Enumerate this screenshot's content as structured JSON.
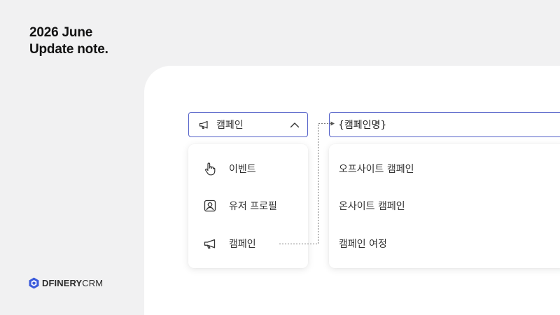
{
  "headline": {
    "line1": "2026 June",
    "line2": "Update note."
  },
  "brand": {
    "bold": "DFINERY",
    "light": "CRM",
    "icon": "dfinery-cube-logo",
    "color": "#3b5bdb"
  },
  "dropdown": {
    "selected_label": "캠페인",
    "icon": "megaphone-icon",
    "chevron": "chevron-up-icon"
  },
  "template_field": {
    "value": "{캠페인명}"
  },
  "menu": {
    "items": [
      {
        "label": "이벤트",
        "icon": "pointer-hand-icon"
      },
      {
        "label": "유저 프로필",
        "icon": "user-profile-icon"
      },
      {
        "label": "캠페인",
        "icon": "megaphone-icon"
      }
    ]
  },
  "submenu": {
    "items": [
      {
        "label": "오프사이트 캠페인"
      },
      {
        "label": "온사이트 캠페인"
      },
      {
        "label": "캠페인 여정"
      }
    ]
  },
  "colors": {
    "accent_border": "#5461c8",
    "background": "#f1f1f2",
    "panel": "#ffffff"
  }
}
